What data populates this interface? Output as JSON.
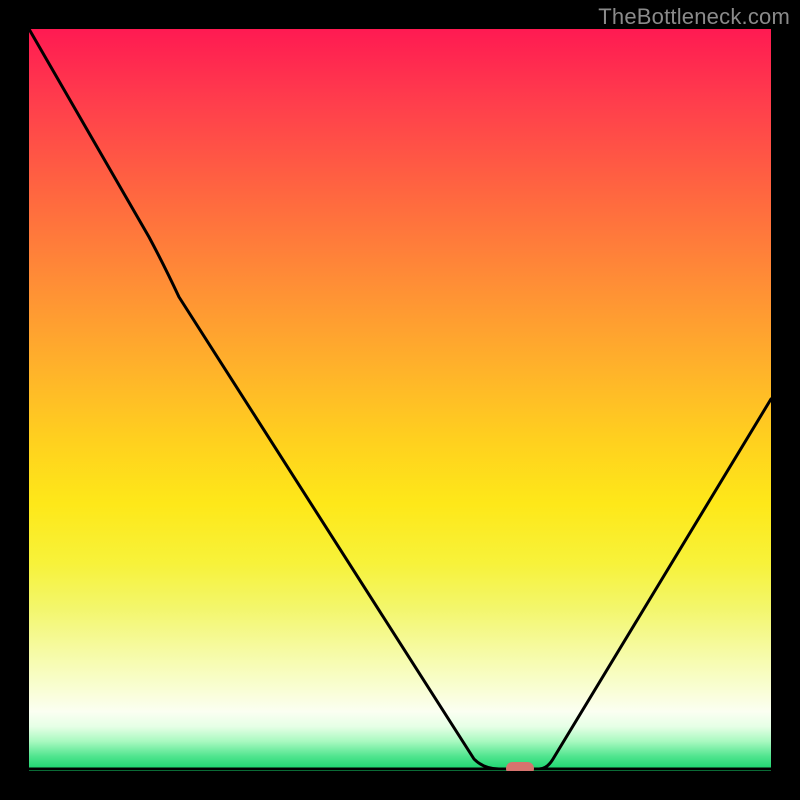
{
  "watermark": "TheBottleneck.com",
  "chart_data": {
    "type": "line",
    "title": "",
    "xlabel": "",
    "ylabel": "",
    "xlim": [
      0,
      100
    ],
    "ylim": [
      0,
      100
    ],
    "grid": false,
    "legend": false,
    "background": "red-yellow-green vertical gradient (red at top = high bottleneck, green at bottom = low bottleneck)",
    "x": [
      0,
      8,
      16,
      20,
      30,
      40,
      50,
      58,
      62,
      65,
      68,
      72,
      80,
      90,
      100
    ],
    "values": [
      100,
      86,
      72,
      64,
      51,
      38,
      25,
      12,
      4,
      0,
      0,
      4,
      15,
      33,
      50
    ],
    "optimal_x": 66,
    "marker": {
      "x": 66,
      "y": 0,
      "color": "#d6736e",
      "shape": "pill"
    },
    "annotations": []
  }
}
